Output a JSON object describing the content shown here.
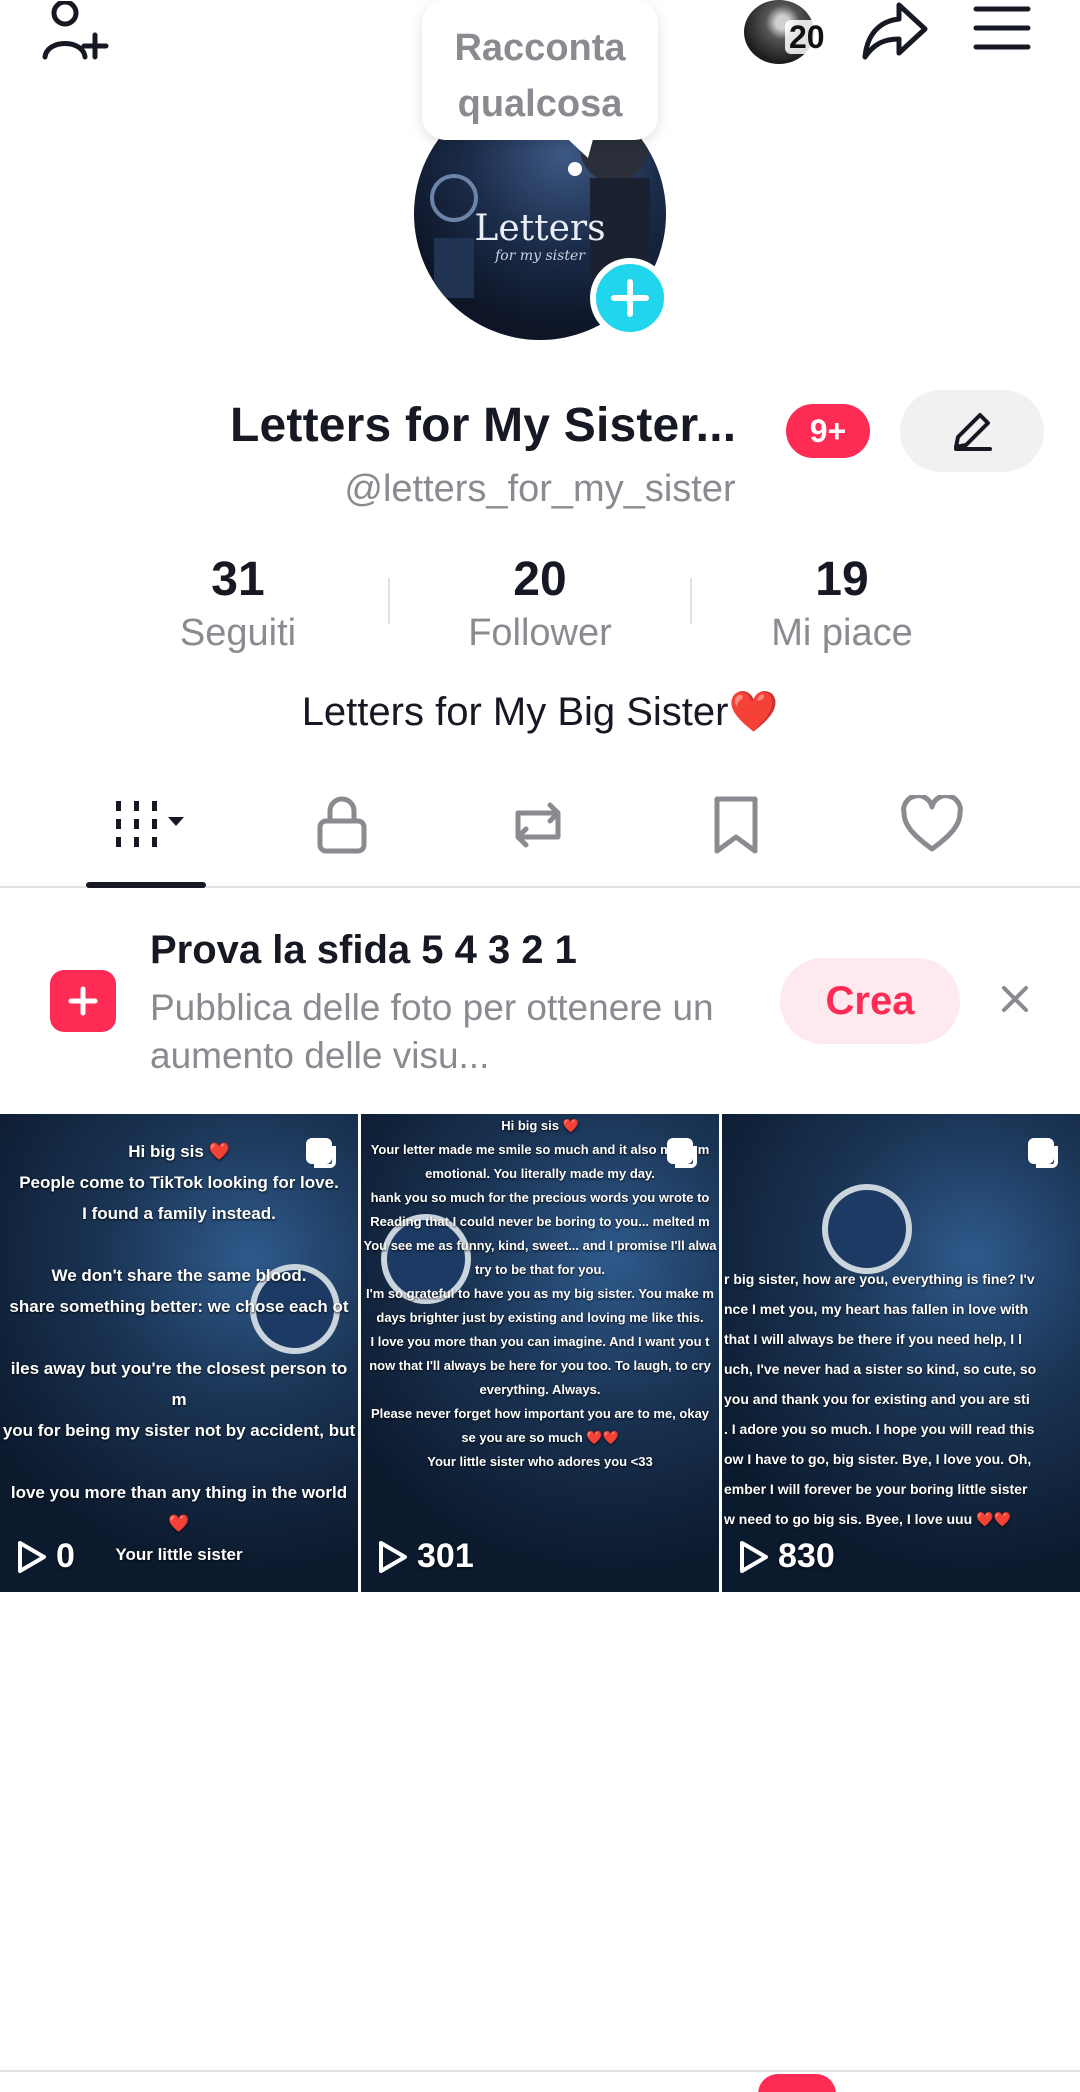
{
  "header": {
    "story_count": "20",
    "tooltip_text": "Racconta qualcosa"
  },
  "profile": {
    "avatar_title": "Letters",
    "avatar_subtitle": "for my sister",
    "name": "Letters for My Sister...",
    "notifications_badge": "9+",
    "handle": "@letters_for_my_sister",
    "bio": "Letters for My Big Sister❤️"
  },
  "stats": [
    {
      "value": "31",
      "label": "Seguiti"
    },
    {
      "value": "20",
      "label": "Follower"
    },
    {
      "value": "19",
      "label": "Mi piace"
    }
  ],
  "tabs": [
    "videos",
    "private",
    "reposts",
    "favorites",
    "liked"
  ],
  "promo": {
    "title": "Prova la sfida 5 4 3 2 1",
    "description": "Pubblica delle foto per ottenere un aumento delle visu...",
    "button": "Crea"
  },
  "videos": [
    {
      "caption": "Hi big sis ❤️\nPeople come to TikTok looking for love.\nI found a family instead.\n\nWe don't share the same blood.\nshare something better: we chose each ot\n\niles away but you're the closest person to m\nyou for being my sister not by accident, but\n\nlove you more than any thing in the world❤️\nYour little sister",
      "views": "0"
    },
    {
      "caption": "Hi big sis ❤️\nYour letter made me smile so much and it also made m\nemotional. You literally made my day.\nhank you so much for the precious words you wrote to\nReading that I could never be boring to you... melted m\nYou see me as funny, kind, sweet... and I promise I'll alwa\ntry to be that for you.\nI'm so grateful to have you as my big sister. You make m\ndays brighter just by existing and loving me like this.\nI love you more than you can imagine. And I want you t\nnow that I'll always be here for you too. To laugh, to cry\neverything. Always.\nPlease never forget how important you are to me, okay\nse you are so much ❤️❤️\nYour little sister who adores you <33",
      "views": "301"
    },
    {
      "caption": "\n\n\n\n\nr big sister, how are you, everything is fine? I'v\nnce I met you, my heart has fallen in love with\n that I will always be there if you need help, I l\nuch, I've never had a sister so kind, so cute, so\n you and thank you for existing and you are sti\n. I adore you so much. I hope you will read this\now I have to go, big sister. Bye, I love you. Oh,\nember I will forever be your boring little sister\nw need to go big sis. Byee, I love uuu ❤️❤️",
      "views": "830"
    }
  ],
  "colors": {
    "accent": "#fe2c55",
    "cyan": "#20d5ec",
    "text_primary": "#161823",
    "text_secondary": "#8a8b91"
  }
}
